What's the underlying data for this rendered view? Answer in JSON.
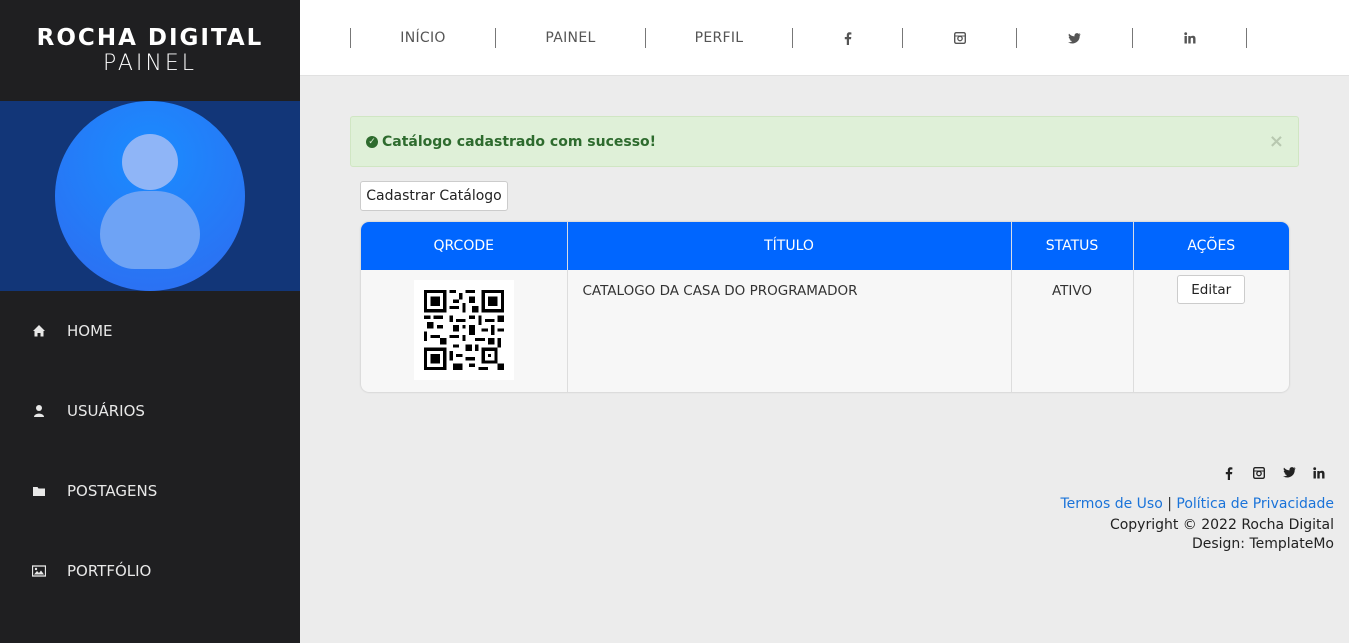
{
  "sidebar": {
    "brand_title": "ROCHA DIGITAL",
    "brand_subtitle": "PAINEL",
    "items": [
      {
        "label": "HOME",
        "icon": "home-icon"
      },
      {
        "label": "USUÁRIOS",
        "icon": "user-icon"
      },
      {
        "label": "POSTAGENS",
        "icon": "folder-icon"
      },
      {
        "label": "PORTFÓLIO",
        "icon": "image-icon"
      }
    ]
  },
  "topnav": {
    "items": [
      "INÍCIO",
      "PAINEL",
      "PERFIL"
    ],
    "social": [
      "facebook-icon",
      "instagram-icon",
      "twitter-icon",
      "linkedin-icon"
    ]
  },
  "alert": {
    "message": "Catálogo cadastrado com sucesso!",
    "close": "×"
  },
  "actions": {
    "new_catalog": "Cadastrar Catálogo"
  },
  "table": {
    "headers": [
      "QRCODE",
      "TÍTULO",
      "STATUS",
      "AÇÕES"
    ],
    "rows": [
      {
        "title": "CATALOGO DA CASA DO PROGRAMADOR",
        "status": "ATIVO",
        "action": "Editar"
      }
    ]
  },
  "footer": {
    "terms": "Termos de Uso",
    "divider": "|",
    "privacy": "Política de Privacidade",
    "copyright": "Copyright © 2022 Rocha Digital",
    "design": "Design: TemplateMo"
  },
  "colors": {
    "sidebar_bg": "#1f1f21",
    "header_blue": "#0066ff",
    "alert_bg": "#dff0d8",
    "alert_text": "#2e6b2e"
  }
}
